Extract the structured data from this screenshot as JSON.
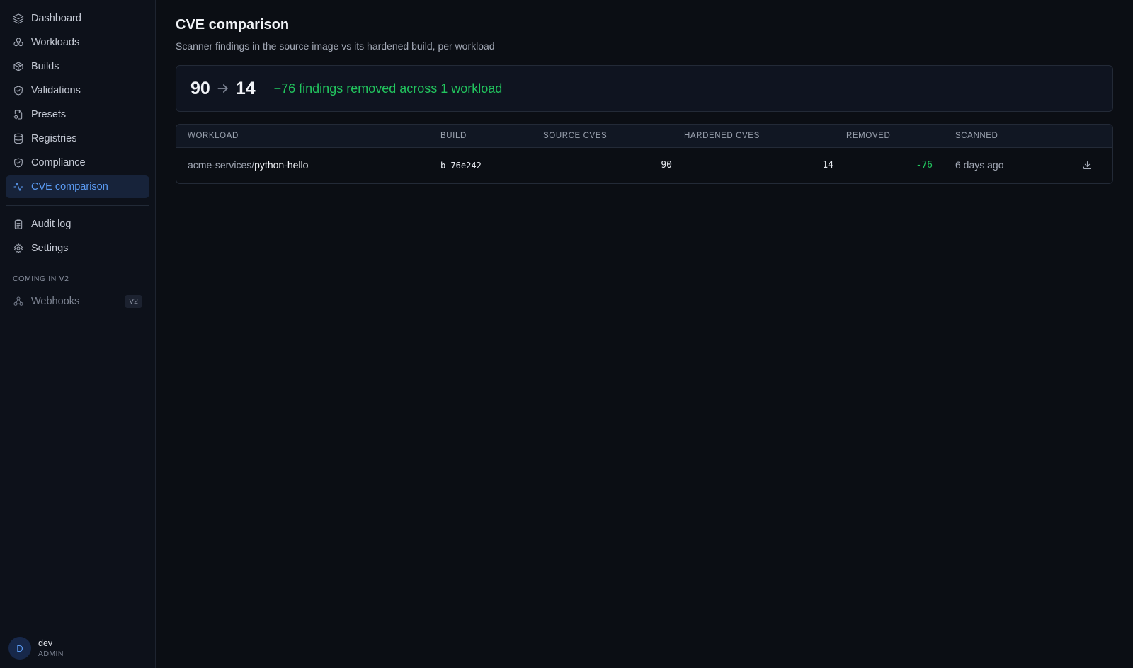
{
  "sidebar": {
    "items": [
      {
        "label": "Dashboard",
        "icon": "layers-icon"
      },
      {
        "label": "Workloads",
        "icon": "workloads-icon"
      },
      {
        "label": "Builds",
        "icon": "package-icon"
      },
      {
        "label": "Validations",
        "icon": "shield-check-icon"
      },
      {
        "label": "Presets",
        "icon": "file-gear-icon"
      },
      {
        "label": "Registries",
        "icon": "database-icon"
      },
      {
        "label": "Compliance",
        "icon": "shield-check-icon"
      },
      {
        "label": "CVE comparison",
        "icon": "activity-icon",
        "active": true
      }
    ],
    "secondary": [
      {
        "label": "Audit log",
        "icon": "clipboard-list-icon"
      },
      {
        "label": "Settings",
        "icon": "gear-icon"
      }
    ],
    "coming_label": "COMING IN V2",
    "coming": [
      {
        "label": "Webhooks",
        "icon": "webhook-icon",
        "badge": "V2"
      }
    ],
    "user": {
      "initial": "D",
      "name": "dev",
      "role": "ADMIN"
    }
  },
  "page": {
    "title": "CVE comparison",
    "subtitle": "Scanner findings in the source image vs its hardened build, per workload"
  },
  "summary": {
    "source_total": "90",
    "hardened_total": "14",
    "delta_text": "−76 findings removed across 1 workload"
  },
  "table": {
    "columns": [
      "WORKLOAD",
      "BUILD",
      "SOURCE CVES",
      "HARDENED CVES",
      "REMOVED",
      "SCANNED"
    ],
    "rows": [
      {
        "namespace": "acme-services/",
        "workload": "python-hello",
        "build": "b-76e242",
        "source_cves": "90",
        "hardened_cves": "14",
        "removed": "-76",
        "scanned": "6 days ago"
      }
    ]
  },
  "colors": {
    "accent": "#5b9bf3",
    "success": "#22c55e",
    "background": "#0b0e14"
  }
}
